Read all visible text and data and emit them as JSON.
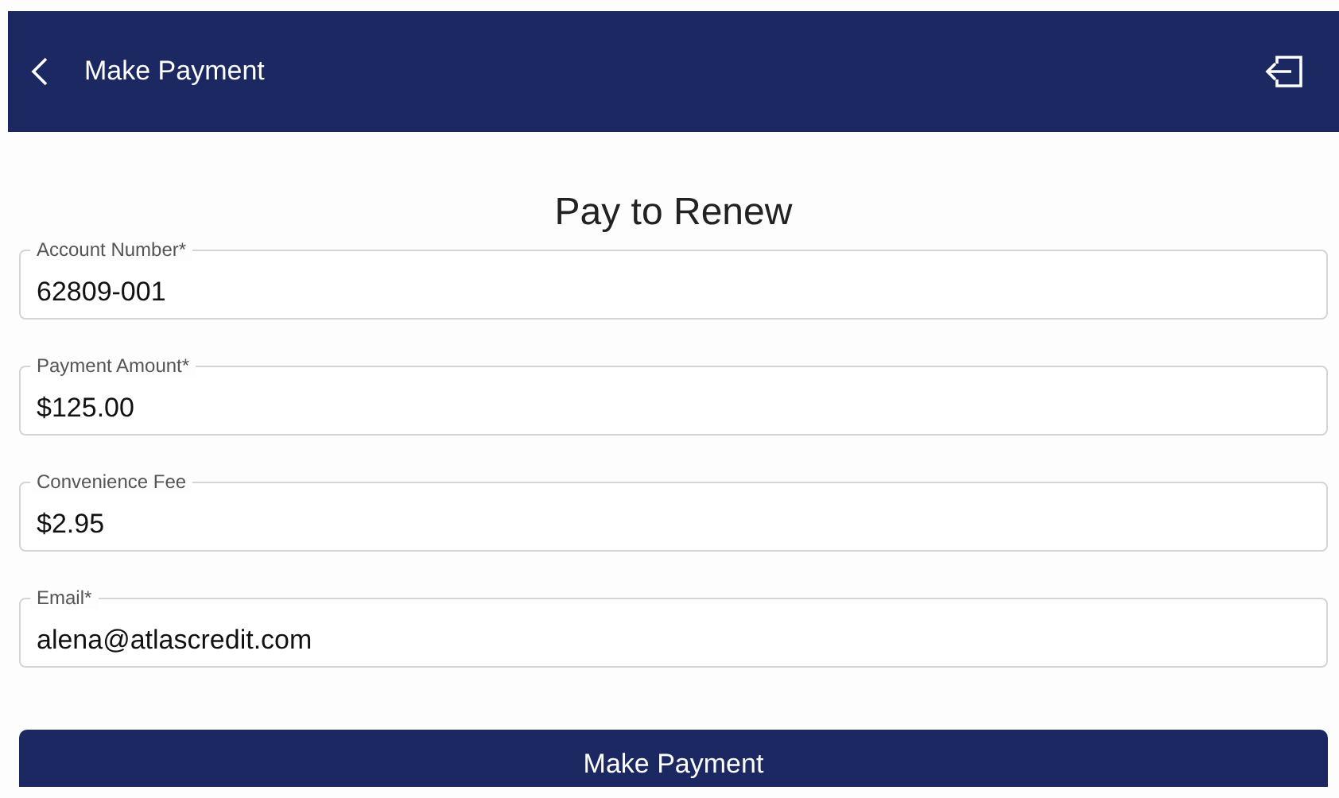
{
  "header": {
    "title": "Make Payment"
  },
  "form": {
    "heading": "Pay to Renew",
    "fields": [
      {
        "label": "Account Number*",
        "value": "62809-001"
      },
      {
        "label": "Payment Amount*",
        "value": "$125.00"
      },
      {
        "label": "Convenience Fee",
        "value": "$2.95"
      },
      {
        "label": "Email*",
        "value": "alena@atlascredit.com"
      }
    ],
    "submit": "Make Payment"
  }
}
